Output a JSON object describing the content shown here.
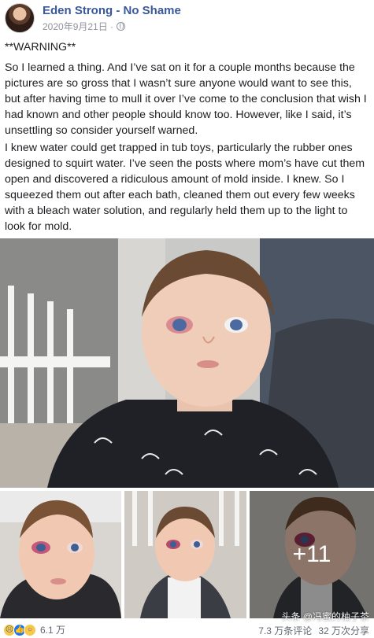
{
  "post": {
    "author": "Eden Strong - No Shame",
    "date": "2020年9月21日 · ",
    "privacy_icon": "globe-icon",
    "paragraphs": [
      "**WARNING**",
      "So I learned a thing. And I’ve sat on it for a couple months because the pictures are so gross that I wasn’t sure anyone would want to see this, but after having time to mull it over I’ve come to the conclusion that wish I had known and other people should know too. However, like I said, it’s unsettling so consider yourself warned.",
      "I knew water could get trapped in tub toys, particularly the rubber ones designed to squirt water. I’ve seen the posts where mom’s have cut them open and discovered a ridiculous amount of mold inside. I knew. So I squeezed them out after each bath, cleaned them out every few weeks with a bleach water solution, and regularly held them up to the light to look for mold."
    ],
    "more_photos": "+11"
  },
  "footer": {
    "reaction_icons": [
      "sad-icon",
      "like-icon",
      "wow-icon"
    ],
    "reaction_count": "6.1 万",
    "comments": "7.3 万条评论",
    "shares": "32 万次分享"
  },
  "watermark": "头条 @冯蜜的柚子茶",
  "colors": {
    "author": "#385898",
    "meta": "#90949c",
    "text": "#1c1e21"
  }
}
